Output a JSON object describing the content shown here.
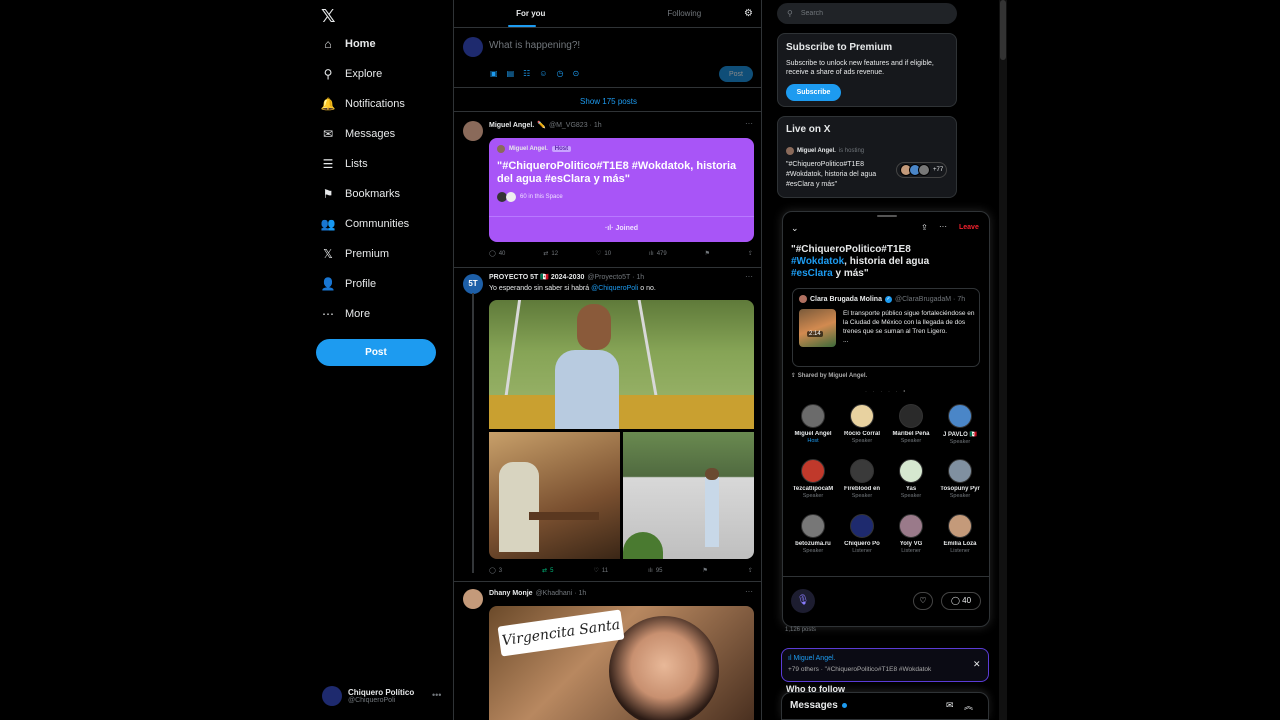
{
  "nav": {
    "items": [
      {
        "label": "Home",
        "icon": "home-icon",
        "glyph": "⌂"
      },
      {
        "label": "Explore",
        "icon": "search-icon",
        "glyph": "⚲"
      },
      {
        "label": "Notifications",
        "icon": "bell-icon",
        "glyph": "🔔"
      },
      {
        "label": "Messages",
        "icon": "envelope-icon",
        "glyph": "✉"
      },
      {
        "label": "Lists",
        "icon": "list-icon",
        "glyph": "☰"
      },
      {
        "label": "Bookmarks",
        "icon": "bookmark-icon",
        "glyph": "⚑"
      },
      {
        "label": "Communities",
        "icon": "people-icon",
        "glyph": "👥"
      },
      {
        "label": "Premium",
        "icon": "x-logo-icon",
        "glyph": "𝕏"
      },
      {
        "label": "Profile",
        "icon": "person-icon",
        "glyph": "👤"
      },
      {
        "label": "More",
        "icon": "more-circle-icon",
        "glyph": "⋯"
      }
    ],
    "post_label": "Post",
    "user": {
      "name": "Chiquero Político",
      "handle": "@ChiqueroPoli"
    }
  },
  "timeline": {
    "tabs": [
      "For you",
      "Following"
    ],
    "compose_placeholder": "What is happening?!",
    "compose_post": "Post",
    "show_posts": "Show 175 posts",
    "posts": [
      {
        "name": "Miguel Angel.",
        "meta": "@M_VG823 · 1h",
        "space": {
          "host": "Miguel Angel.",
          "host_badge": "Host",
          "title": "\"#ChiqueroPolitico#T1E8 #Wokdatok, historia del agua #esClara y más\"",
          "listeners": "60 in this Space",
          "joined": "Joined"
        },
        "stats": [
          "40",
          "12",
          "10",
          "479"
        ]
      },
      {
        "name": "PROYECTO 5T 🇲🇽 2024-2030",
        "meta": "@Proyecto5T · 1h",
        "text": "Yo esperando sin saber si habrá",
        "mention": "@ChiqueroPoli",
        "text_end": "o no.",
        "stats": [
          "3",
          "5",
          "11",
          "95"
        ]
      },
      {
        "name": "Dhany Monje",
        "meta": "@Khadhani · 1h",
        "sticker": "Virgencita Santa"
      }
    ]
  },
  "right": {
    "search_placeholder": "Search",
    "premium": {
      "title": "Subscribe to Premium",
      "text": "Subscribe to unlock new features and if eligible, receive a share of ads revenue.",
      "button": "Subscribe"
    },
    "live": {
      "title": "Live on X",
      "host": "Miguel Angel.",
      "meta": "is hosting",
      "space_title": "\"#ChiqueroPolitico#T1E8 #Wokdatok, historia del agua #esClara y más\"",
      "count": "+77"
    },
    "dock": {
      "leave": "Leave",
      "title_a": "\"#ChiqueroPolitico#T1E8",
      "title_hl1": "#Wokdatok",
      "title_b": ", historia del agua",
      "title_hl2": "#esClara",
      "title_c": " y más\"",
      "quote": {
        "name": "Clara Brugada Molina",
        "meta": "@ClaraBrugadaM · 7h",
        "text": "El transporte público sigue fortaleciéndose en la Ciudad de México con la llegada de dos trenes que se suman al Tren Ligero.",
        "more": "...",
        "video_time": "2:14"
      },
      "shared": "Shared by Miguel Angel.",
      "people": [
        {
          "name": "Miguel Angel",
          "role": "Host",
          "color": "#6b6b6b"
        },
        {
          "name": "Rocío Corral",
          "role": "Speaker",
          "color": "#e8d2a0"
        },
        {
          "name": "Maribel Peña",
          "role": "Speaker",
          "color": "#2a2a2a"
        },
        {
          "name": "J PAVLO 🇲🇽",
          "role": "Speaker",
          "color": "#4a86c8"
        },
        {
          "name": "TezcatlipocaM",
          "role": "Speaker",
          "color": "#c0392b"
        },
        {
          "name": "Fireblood en",
          "role": "Speaker",
          "color": "#3a3a3a"
        },
        {
          "name": "Yas",
          "role": "Speaker",
          "color": "#d6e8d0"
        },
        {
          "name": "Tosopuny Pyr",
          "role": "Speaker",
          "color": "#8090a0"
        },
        {
          "name": "betozuma.ru",
          "role": "Speaker",
          "color": "#777777"
        },
        {
          "name": "Chiquero Po",
          "role": "Listener",
          "color": "#1e2a6e"
        },
        {
          "name": "Yoly VG",
          "role": "Listener",
          "color": "#9a7a8a"
        },
        {
          "name": "Emilia Loza",
          "role": "Listener",
          "color": "#c49a7a"
        }
      ],
      "comments": "40"
    },
    "posts_count": "1,126 posts",
    "mini_space": {
      "host": "Miguel Angel.",
      "line2": "+79 others · \"#ChiqueroPolitico#T1E8 #Wokdatok"
    },
    "who_to_follow": "Who to follow",
    "messages": "Messages"
  }
}
